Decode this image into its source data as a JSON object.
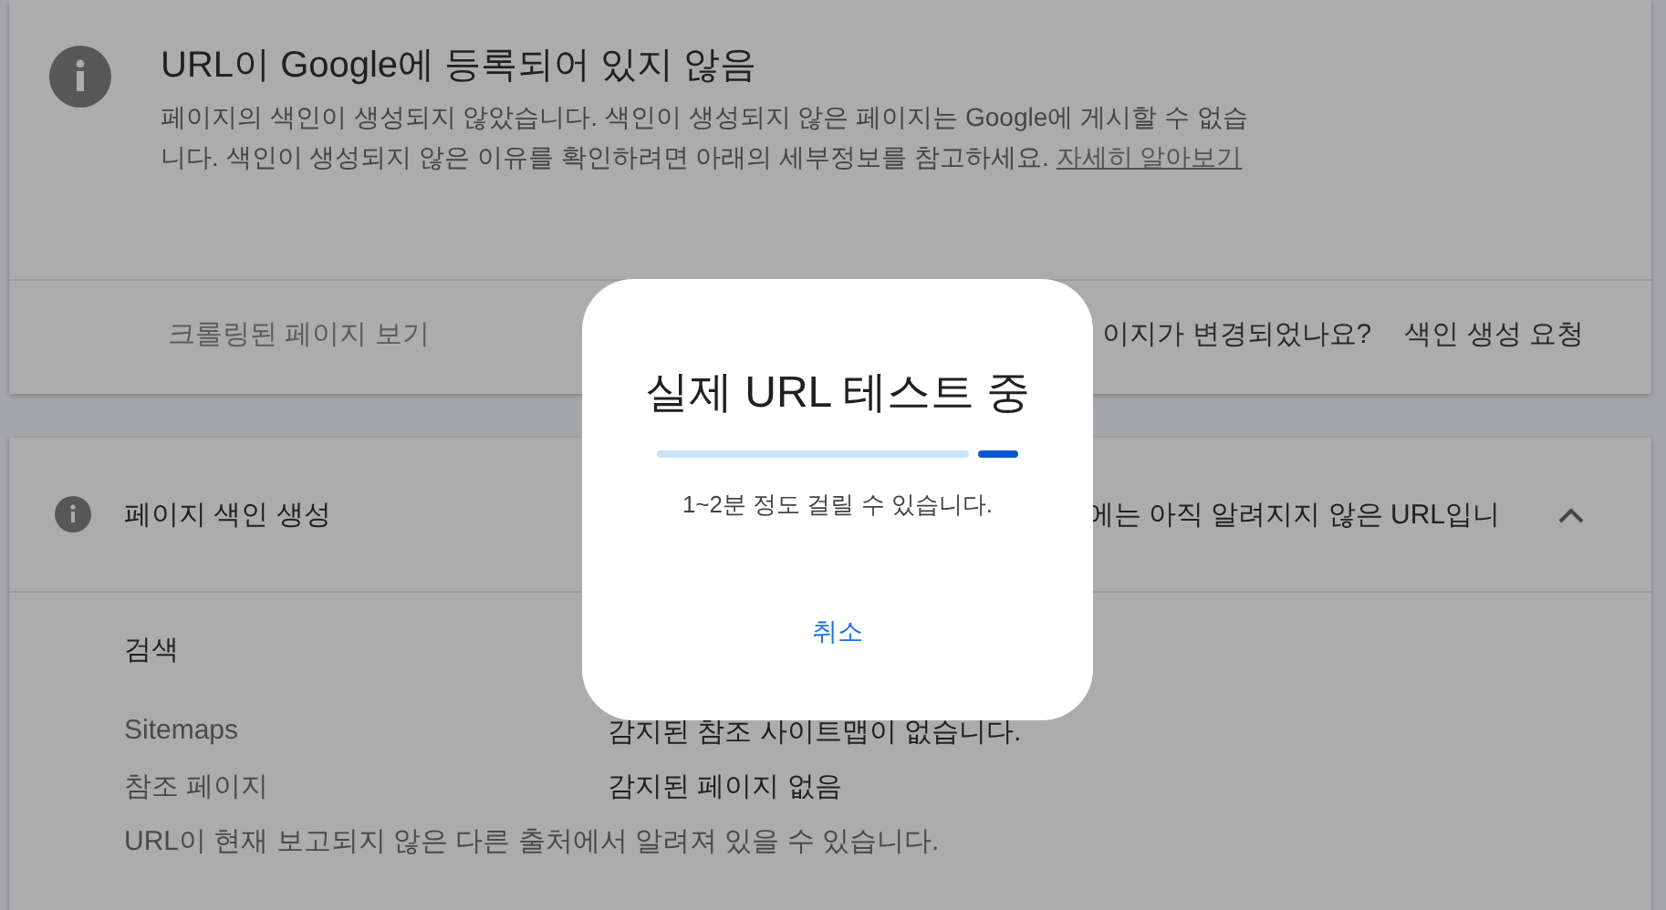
{
  "status_card": {
    "title": "URL이 Google에 등록되어 있지 않음",
    "description": "페이지의 색인이 생성되지 않았습니다. 색인이 생성되지 않은 페이지는 Google에 게시할 수 없습니다. 색인이 생성되지 않은 이유를 확인하려면 아래의 세부정보를 참고하세요.",
    "link": "자세히 알아보기",
    "actions": [
      {
        "label": "크롤링된 페이지 보기",
        "disabled": true
      },
      {
        "label": "이지가 변경되었나요?",
        "kind": "text"
      },
      {
        "label": "색인 생성 요청",
        "disabled": false
      }
    ]
  },
  "indexing_card": {
    "title": "페이지 색인 생성",
    "summary": "에는 아직 알려지지 않은 URL입니",
    "expanded": true,
    "section": "검색",
    "rows": [
      {
        "label": "Sitemaps",
        "value": "감지된 참조 사이트맵이 없습니다."
      },
      {
        "label": "참조 페이지",
        "value": "감지된 페이지 없음"
      }
    ],
    "note": "URL이 현재 보고되지 않은 다른 출처에서 알려져 있을 수 있습니다."
  },
  "dialog": {
    "title": "실제 URL 테스트 중",
    "progress": {
      "level": 0.11
    },
    "message": "1~2분 정도 걸릴 수 있습니다.",
    "button": "취소"
  }
}
